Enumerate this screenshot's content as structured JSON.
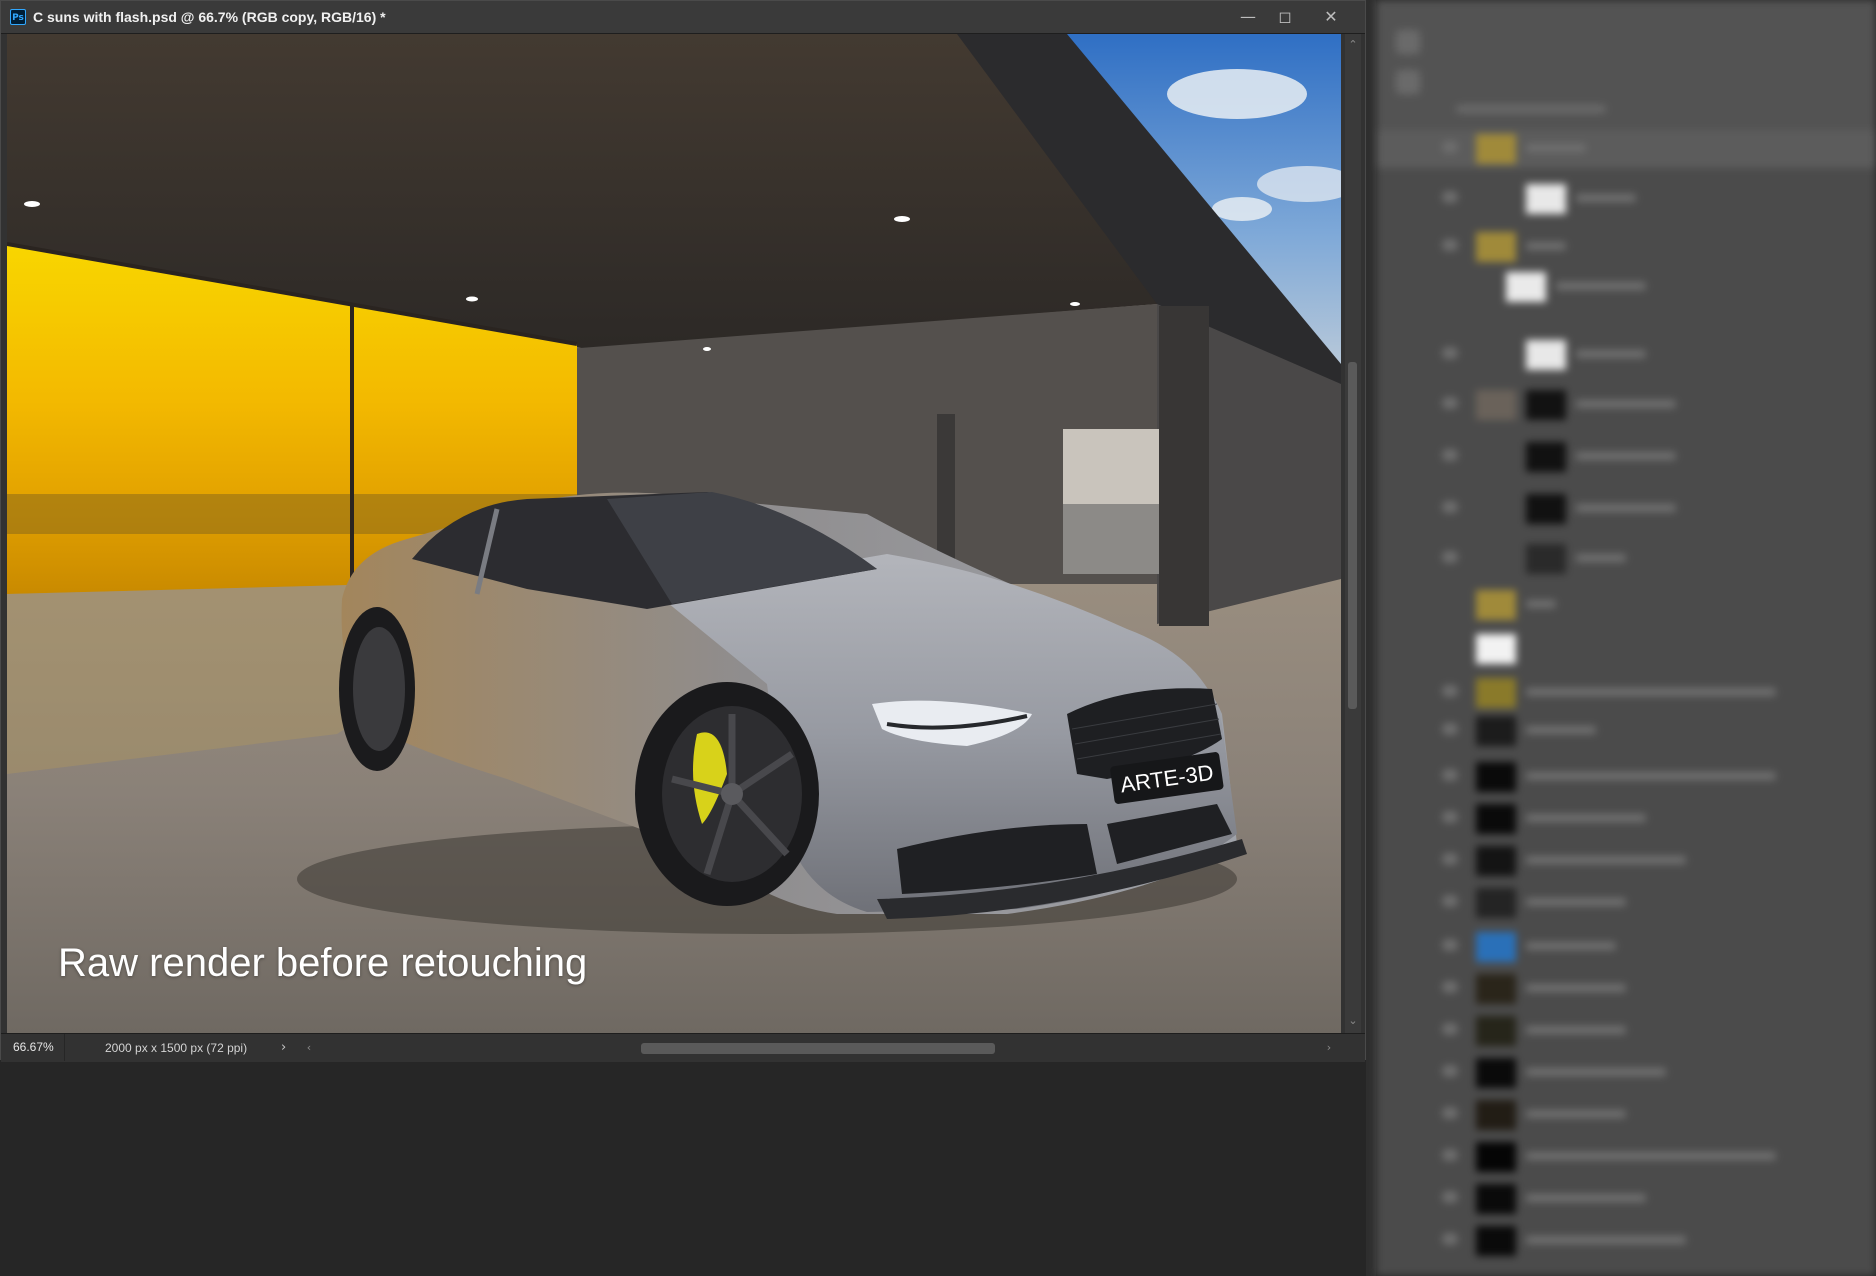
{
  "window": {
    "app_icon_label": "Ps",
    "title": "C suns with flash.psd @ 66.7% (RGB copy, RGB/16) *",
    "buttons": {
      "minimize": "—",
      "maximize": "◻",
      "close": "✕"
    }
  },
  "canvas": {
    "caption": "Raw render before retouching",
    "license_plate": "ARTE-3D"
  },
  "status_bar": {
    "zoom": "66.67%",
    "doc_info": "2000 px x 1500 px (72 ppi)",
    "expand_arrow": "›"
  },
  "scrollbars": {
    "up_arrow": "⌃",
    "down_arrow": "⌄",
    "left_arrow": "‹",
    "right_arrow": "›"
  },
  "colors": {
    "sunset_yellow": "#f5c400",
    "car_body": "#9a9ca3",
    "brake_caliper": "#d8d21a",
    "panel_bg": "#4b4b4b"
  },
  "layers_panel": {
    "blurred": true
  }
}
